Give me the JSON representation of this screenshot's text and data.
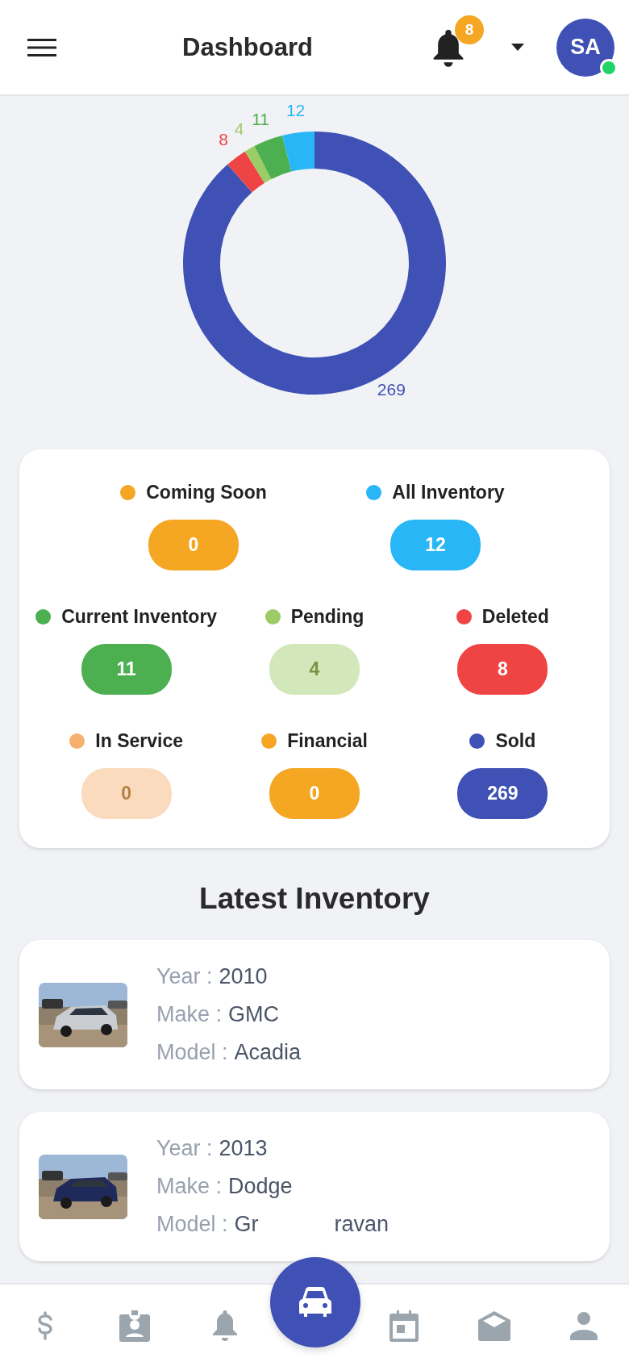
{
  "header": {
    "title": "Dashboard",
    "notification_count": "8",
    "avatar_initials": "SA",
    "online": true
  },
  "chart": {
    "chart_data": {
      "type": "donut",
      "values": [
        269,
        8,
        4,
        11,
        12
      ],
      "colors": [
        "#3f51b5",
        "#ef4444",
        "#9ccc65",
        "#4caf50",
        "#29b6f6"
      ],
      "data_labels": true
    }
  },
  "status_rows": [
    [
      {
        "label": "Coming Soon",
        "value": "0",
        "color": "#f5a623",
        "kind": "solid"
      },
      {
        "label": "All Inventory",
        "value": "12",
        "color": "#29b6f6",
        "kind": "solid"
      }
    ],
    [
      {
        "label": "Current Inventory",
        "value": "11",
        "color": "#4caf50",
        "kind": "solid"
      },
      {
        "label": "Pending",
        "value": "4",
        "color": "#9ccc65",
        "kind": "soft"
      },
      {
        "label": "Deleted",
        "value": "8",
        "color": "#ef4444",
        "kind": "solid"
      }
    ],
    [
      {
        "label": "In Service",
        "value": "0",
        "color": "#f5b06e",
        "kind": "soft"
      },
      {
        "label": "Financial",
        "value": "0",
        "color": "#f5a623",
        "kind": "solid"
      },
      {
        "label": "Sold",
        "value": "269",
        "color": "#3f51b5",
        "kind": "solid"
      }
    ]
  ],
  "section_title": "Latest Inventory",
  "inventory": [
    {
      "fields": [
        {
          "label": "Year :",
          "value": "2010"
        },
        {
          "label": "Make :",
          "value": "GMC"
        },
        {
          "label": "Model :",
          "value": "Acadia"
        }
      ]
    },
    {
      "fields": [
        {
          "label": "Year :",
          "value": "2013"
        },
        {
          "label": "Make :",
          "value": "Dodge"
        },
        {
          "label": "Model :",
          "value": "Gr",
          "value_tail": "ravan"
        }
      ]
    }
  ],
  "nav": [
    {
      "kind": "dollar"
    },
    {
      "kind": "badge"
    },
    {
      "kind": "bell"
    },
    {
      "kind": "car"
    },
    {
      "kind": "calendar"
    },
    {
      "kind": "mail"
    },
    {
      "kind": "person"
    }
  ]
}
